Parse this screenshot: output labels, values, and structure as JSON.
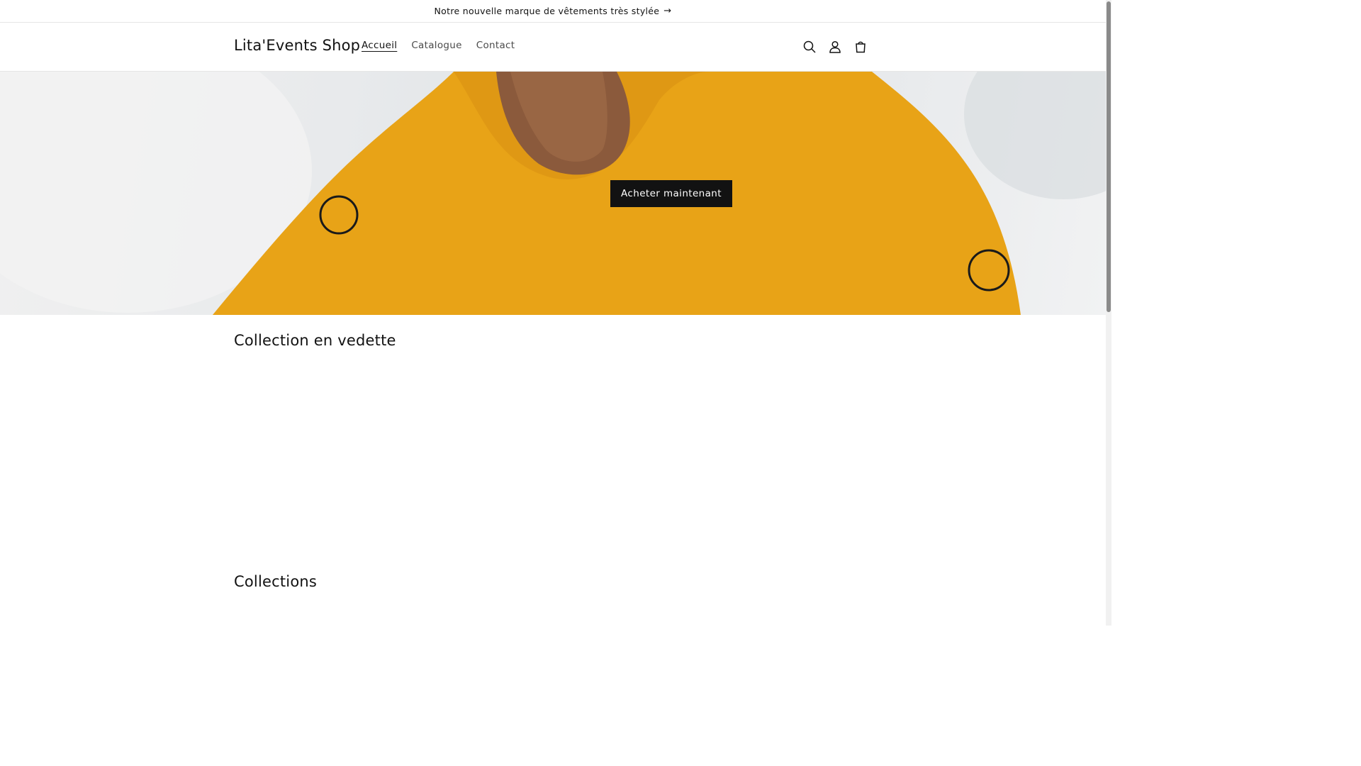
{
  "announcement": {
    "text": "Notre nouvelle marque de vêtements très stylée",
    "arrow": "→"
  },
  "header": {
    "logo": "Lita'Events Shop",
    "nav": [
      {
        "label": "Accueil",
        "active": true
      },
      {
        "label": "Catalogue",
        "active": false
      },
      {
        "label": "Contact",
        "active": false
      }
    ],
    "icons": [
      "search-icon",
      "account-icon",
      "cart-icon"
    ]
  },
  "hero": {
    "button_label": "Acheter maintenant",
    "image_description_colors": {
      "shirt": "#E8A317",
      "hair": "#8B5A3C",
      "background": "#E4E7EA"
    }
  },
  "sections": {
    "featured_title": "Collection en vedette",
    "collections_title": "Collections"
  },
  "colors": {
    "text": "#121212",
    "button_bg": "#121212",
    "button_text": "#FFFFFF",
    "border": "#E6E6E6"
  }
}
